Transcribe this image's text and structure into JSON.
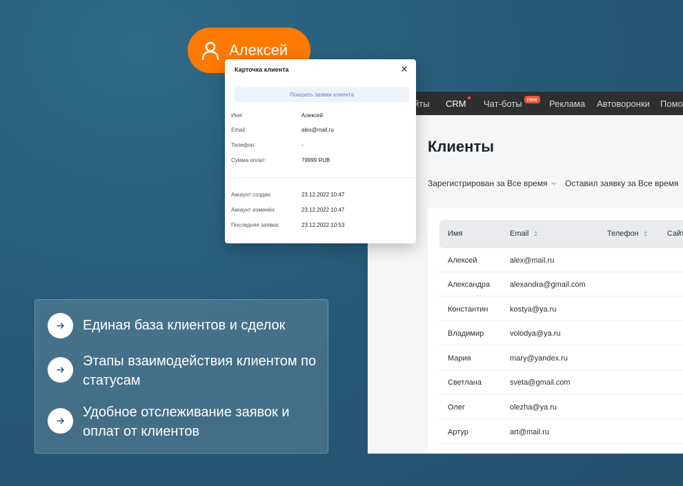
{
  "badge": {
    "name": "Алексей",
    "icon": "user-icon",
    "color": "#ff7a00"
  },
  "nav": {
    "items": [
      {
        "label": "йты"
      },
      {
        "label": "CRM"
      },
      {
        "label": "Чат-боты",
        "badge": "new"
      },
      {
        "label": "Реклама"
      },
      {
        "label": "Автоворонки"
      },
      {
        "label": "Помо"
      }
    ]
  },
  "page": {
    "title": "Клиенты",
    "filters": [
      "Зарегистрирован за Все время",
      "Оставил заявку за Все время"
    ]
  },
  "table": {
    "headers": [
      "Имя",
      "Email",
      "Телефон",
      "Сайт"
    ],
    "rows": [
      {
        "name": "Алексей",
        "email": "alex@mail.ru"
      },
      {
        "name": "Александра",
        "email": "alexandra@gmail.com"
      },
      {
        "name": "Константин",
        "email": "kostya@ya.ru"
      },
      {
        "name": "Владимир",
        "email": "volodya@ya.ru"
      },
      {
        "name": "Мария",
        "email": "mary@yandex.ru"
      },
      {
        "name": "Светлана",
        "email": "sveta@gmail.com"
      },
      {
        "name": "Олег",
        "email": "olezha@ya.ru"
      },
      {
        "name": "Артур",
        "email": "art@mail.ru"
      }
    ]
  },
  "card": {
    "title": "Карточка клиента",
    "button": "Показать заявки клиента",
    "fields": [
      {
        "label": "Имя:",
        "value": "Алексей"
      },
      {
        "label": "Email:",
        "value": "alex@mail.ru"
      },
      {
        "label": "Телефон:",
        "value": "-"
      },
      {
        "label": "Сумма оплат:",
        "value": "79999 RUB"
      }
    ],
    "meta": [
      {
        "label": "Аккаунт создан:",
        "value": "23.12.2022 10:47"
      },
      {
        "label": "Аккаунт изменён:",
        "value": "23.12.2022 10:47"
      },
      {
        "label": "Последняя заявка:",
        "value": "23.12.2022 10:53"
      }
    ]
  },
  "features": [
    {
      "text": "Единая база клиентов и сделок"
    },
    {
      "text": "Этапы взаимодействия клиентом по статусам"
    },
    {
      "text": "Удобное отслеживание заявок и оплат от клиентов"
    }
  ]
}
